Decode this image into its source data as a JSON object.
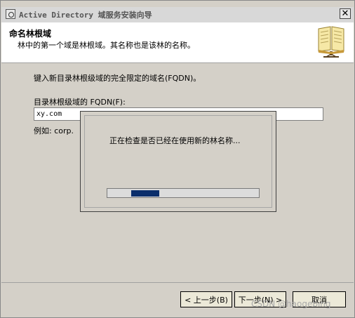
{
  "window": {
    "title": "Active Directory 域服务安装向导",
    "close_glyph": "✕"
  },
  "header": {
    "title": "命名林根域",
    "subtitle": "林中的第一个域是林根域。其名称也是该林的名称。",
    "icon": "book-icon"
  },
  "body": {
    "instruction": "键入新目录林根级域的完全限定的域名(FQDN)。",
    "field_label": "目录林根级域的 FQDN(F):",
    "field_value": "xy.com",
    "example": "例如: corp."
  },
  "progress_dialog": {
    "message": "正在检查是否已经在使用新的林名称...",
    "progress_indeterminate": true,
    "color": "#0b2e6b"
  },
  "buttons": {
    "back": "< 上一步(B)",
    "next": "下一步(N) >",
    "cancel": "取消"
  },
  "watermark": "CSDN @haogebing"
}
